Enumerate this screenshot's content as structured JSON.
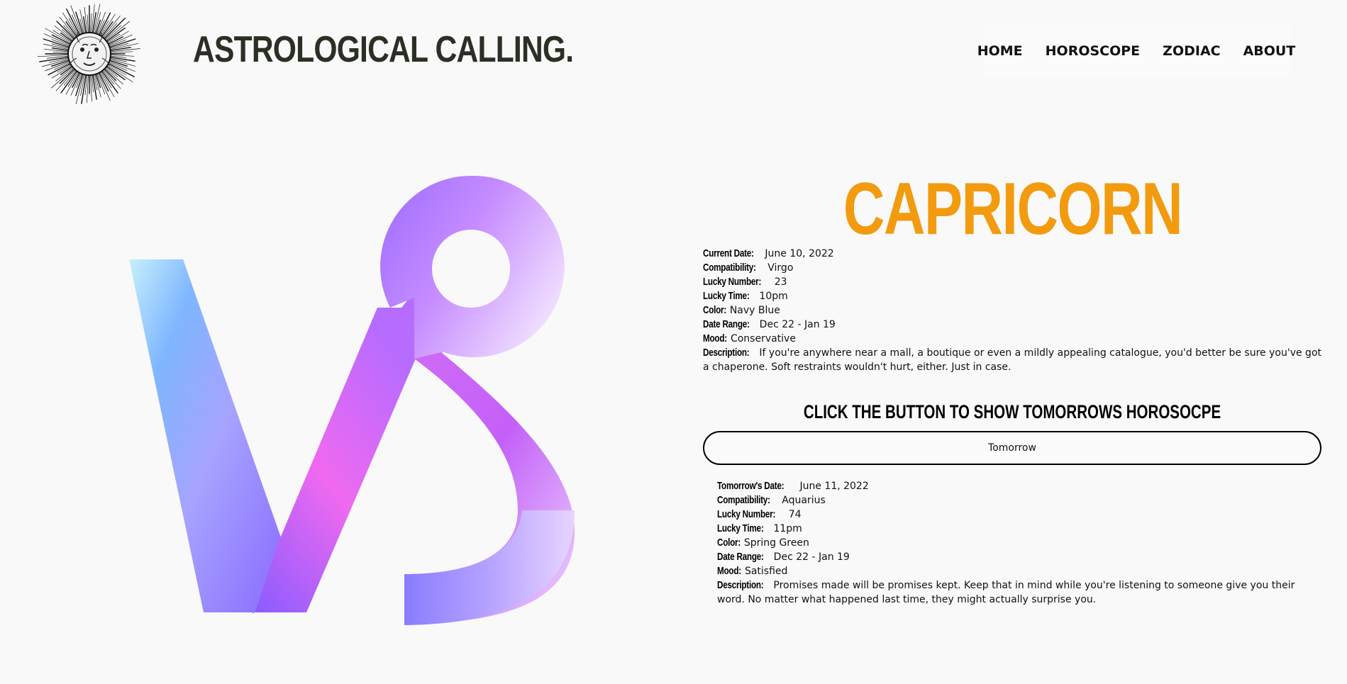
{
  "header": {
    "site_title": "ASTROLOGICAL CALLING.",
    "logo_icon": "sun-face-icon",
    "nav": [
      {
        "label": "HOME"
      },
      {
        "label": "HOROSCOPE"
      },
      {
        "label": "ZODIAC"
      },
      {
        "label": "ABOUT"
      }
    ]
  },
  "sign": {
    "name": "CAPRICORN",
    "symbol_icon": "capricorn-symbol-icon",
    "title_color": "#f29b0f"
  },
  "today": {
    "current_date_label": "Current Date:",
    "current_date": "June 10, 2022",
    "compatibility_label": "Compatibility:",
    "compatibility": "Virgo",
    "lucky_number_label": "Lucky Number:",
    "lucky_number": "23",
    "lucky_time_label": "Lucky Time:",
    "lucky_time": "10pm",
    "color_label": "Color:",
    "color": "Navy Blue",
    "date_range_label": "Date Range:",
    "date_range": "Dec 22 - Jan 19",
    "mood_label": "Mood:",
    "mood": "Conservative",
    "description_label": "Description:",
    "description": "If you're anywhere near a mall, a boutique or even a mildly appealing catalogue, you'd better be sure you've got a chaperone. Soft restraints wouldn't hurt, either. Just in case."
  },
  "cta": {
    "heading": "CLICK THE BUTTON TO SHOW TOMORROWS HOROSOCPE",
    "button_label": "Tomorrow"
  },
  "tomorrow": {
    "date_label": "Tomorrow's Date:",
    "date": "June 11, 2022",
    "compatibility_label": "Compatibility:",
    "compatibility": "Aquarius",
    "lucky_number_label": "Lucky Number:",
    "lucky_number": "74",
    "lucky_time_label": "Lucky Time:",
    "lucky_time": "11pm",
    "color_label": "Color:",
    "color": "Spring Green",
    "date_range_label": "Date Range:",
    "date_range": "Dec 22 - Jan 19",
    "mood_label": "Mood:",
    "mood": "Satisfied",
    "description_label": "Description:",
    "description": "Promises made will be promises kept. Keep that in mind while you're listening to someone give you their word. No matter what happened last time, they might actually surprise you."
  }
}
